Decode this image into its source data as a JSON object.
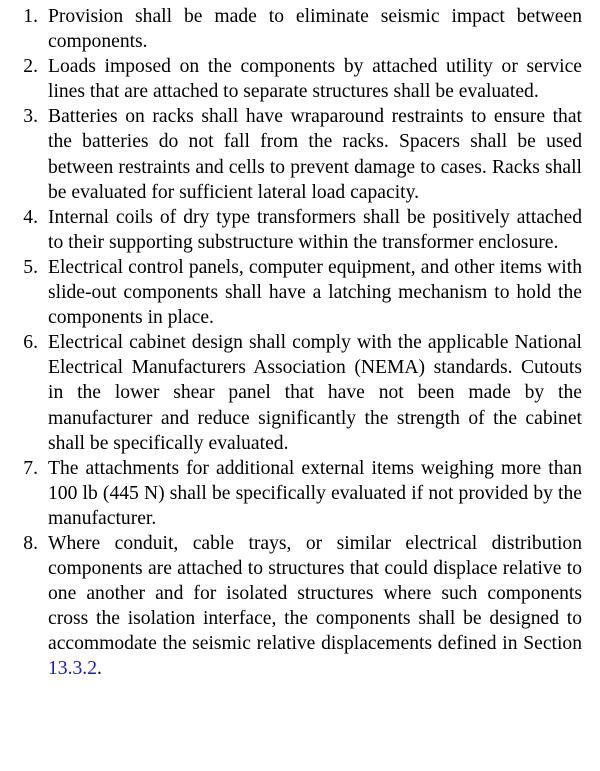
{
  "items": [
    {
      "number": "1.",
      "text": "Provision shall be made to eliminate seismic impact be­tween components."
    },
    {
      "number": "2.",
      "text": "Loads imposed on the components by attached utility or service lines that are attached to separate structures shall be evaluated."
    },
    {
      "number": "3.",
      "text": "Batteries on racks shall have wraparound restraints to ensure that the batteries do not fall from the racks. Spacers shall be used between restraints and cells to prevent damage to cases. Racks shall be evaluated for sufficient lateral load capacity."
    },
    {
      "number": "4.",
      "text": "Internal coils of dry type transformers shall be positively attached to their supporting substructure within the trans­former enclosure."
    },
    {
      "number": "5.",
      "text": "Electrical control panels, computer equipment, and other items with slide-out components shall have a latching mechanism to hold the components in place."
    },
    {
      "number": "6.",
      "text": "Electrical cabinet design shall comply with the applicable National Electrical Manufacturers Association (NEMA) stan­dards. Cutouts in the lower shear panel that have not been made by the manufacturer and reduce significantly the strength of the cabinet shall be specifically evaluated."
    },
    {
      "number": "7.",
      "text": "The attachments for additional external items weighing more than 100 lb (445 N) shall be specifically evaluated if not provided by the manufacturer."
    },
    {
      "number": "8.",
      "text_before": "Where conduit, cable trays, or similar electrical distribution components are attached to structures that could displace relative to one another and for isolated structures where such components cross the isolation interface, the compo­nents shall be designed to accommodate the seismic rela­tive displacements defined in Section ",
      "link": "13.3.2",
      "text_after": "."
    }
  ],
  "colors": {
    "text": "#000000",
    "link": "#1a1ad6",
    "background": "#ffffff"
  }
}
